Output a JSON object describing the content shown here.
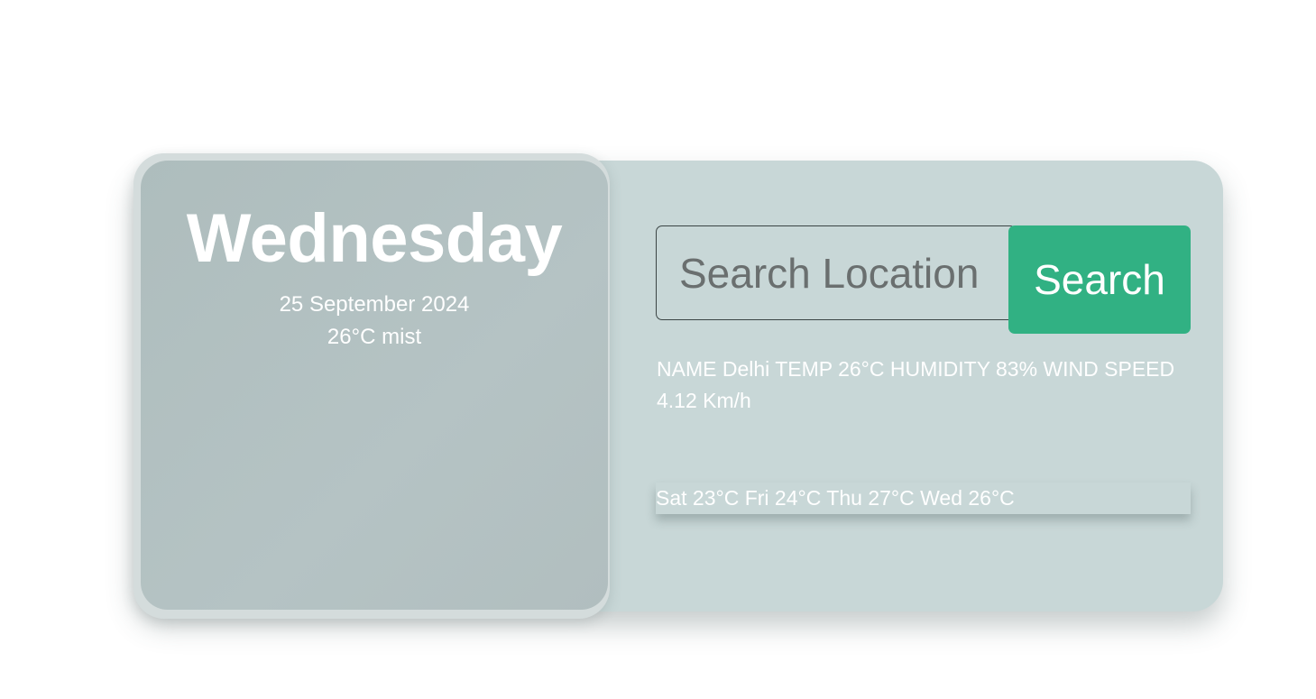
{
  "current": {
    "day": "Wednesday",
    "date": "25 September 2024",
    "summary": "26°C mist"
  },
  "search": {
    "placeholder": "Search Location",
    "button_label": "Search"
  },
  "details": {
    "text_line": "NAME Delhi TEMP 26°C HUMIDITY 83% WIND SPEED 4.12 Km/h"
  },
  "forecast": [
    {
      "label": "Sat 23°C"
    },
    {
      "label": "Fri 24°C"
    },
    {
      "label": "Thu 27°C"
    },
    {
      "label": "Wed 26°C"
    }
  ],
  "colors": {
    "background": "#ffffff",
    "card": "#c8d7d7",
    "left_panel": "#b1bfc0",
    "button": "#31b183",
    "text": "#ffffff"
  }
}
